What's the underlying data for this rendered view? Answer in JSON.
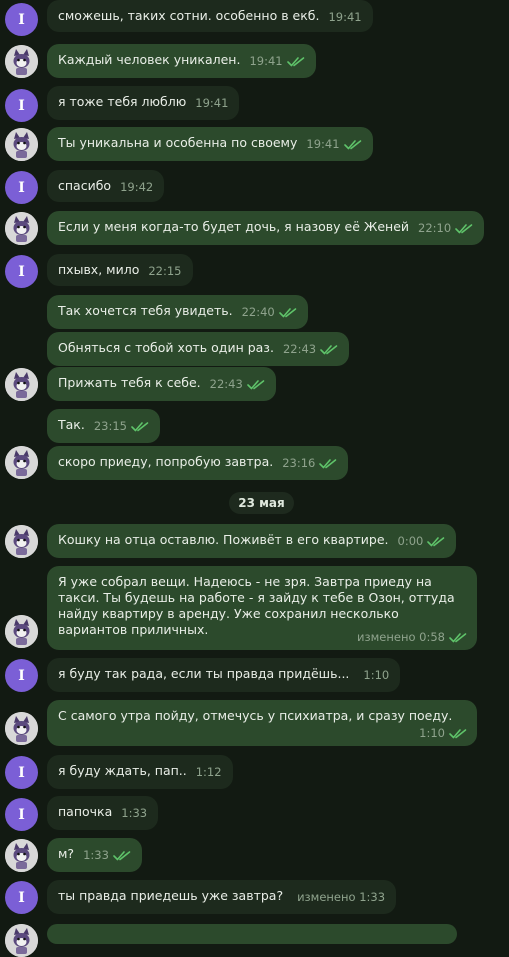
{
  "avatar_letter": "I",
  "date_divider": "23 мая",
  "messages": [
    {
      "text": "сможешь, таких сотни. особенно в екб.",
      "time": "19:41"
    },
    {
      "text": "Каждый человек уникален.",
      "time": "19:41"
    },
    {
      "text": "я тоже тебя люблю",
      "time": "19:41"
    },
    {
      "text": "Ты уникальна и особенна по своему",
      "time": "19:41"
    },
    {
      "text": "спасибо",
      "time": "19:42"
    },
    {
      "text": "Если у меня когда-то будет дочь, я назову её Женей",
      "time": "22:10"
    },
    {
      "text": "пхывх, мило",
      "time": "22:15"
    },
    {
      "text": "Так хочется тебя увидеть.",
      "time": "22:40"
    },
    {
      "text": "Обняться с тобой хоть один раз.",
      "time": "22:43"
    },
    {
      "text": "Прижать тебя к себе.",
      "time": "22:43"
    },
    {
      "text": "Так.",
      "time": "23:15"
    },
    {
      "text": "скоро приеду, попробую завтра.",
      "time": "23:16"
    },
    {
      "text": "Кошку на отца оставлю. Поживёт в его квартире.",
      "time": "0:00"
    },
    {
      "text": "Я уже собрал вещи. Надеюсь - не зря. Завтра приеду на такси. Ты будешь на работе - я зайду к тебе в Озон, оттуда найду квартиру в аренду. Уже сохранил несколько вариантов приличных.",
      "time": "изменено 0:58"
    },
    {
      "text": "я буду так рада, если ты правда придёшь...",
      "time": "1:10"
    },
    {
      "text": "С самого утра пойду, отмечусь у психиатра, и сразу поеду.",
      "time": "1:10"
    },
    {
      "text": "я буду ждать, пап..",
      "time": "1:12"
    },
    {
      "text": "папочка",
      "time": "1:33"
    },
    {
      "text": "м?",
      "time": "1:33"
    },
    {
      "text": "ты правда приедешь уже завтра?",
      "time": "изменено 1:33"
    }
  ],
  "colors": {
    "background": "#121a12",
    "incoming_bubble": "#1d2a1d",
    "outgoing_bubble": "#2c4a2c",
    "read_ticks": "#5fc36a",
    "letter_avatar": "#7b5fd6"
  },
  "icons": {
    "letter_avatar": "letter-avatar",
    "photo_avatar": "cat-photo-avatar",
    "read_status": "double-check-icon"
  }
}
